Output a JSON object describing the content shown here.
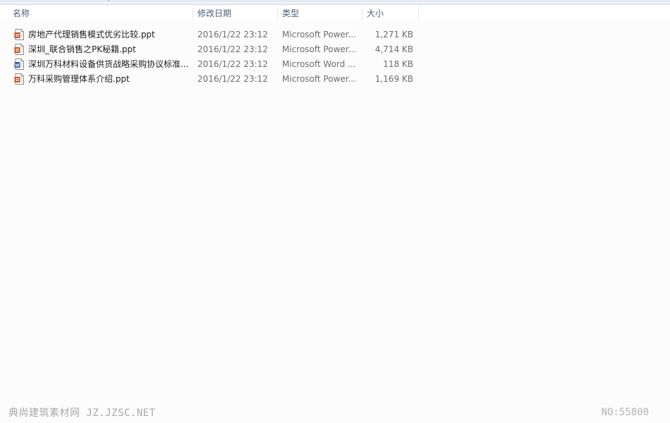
{
  "columns": {
    "name": "名称",
    "date": "修改日期",
    "type": "类型",
    "size": "大小"
  },
  "sort": {
    "column": "name",
    "indicator": "˄"
  },
  "files": [
    {
      "name": "房地产代理销售模式优劣比较.ppt",
      "date": "2016/1/22 23:12",
      "type": "Microsoft Power...",
      "size": "1,271 KB",
      "icon": "powerpoint-file-icon"
    },
    {
      "name": "深圳_联合销售之PK秘籍.ppt",
      "date": "2016/1/22 23:12",
      "type": "Microsoft Power...",
      "size": "4,714 KB",
      "icon": "powerpoint-file-icon"
    },
    {
      "name": "深圳万科材料设备供货战略采购协议标准...",
      "date": "2016/1/22 23:12",
      "type": "Microsoft Word ...",
      "size": "118 KB",
      "icon": "word-file-icon"
    },
    {
      "name": "万科采购管理体系介绍.ppt",
      "date": "2016/1/22 23:12",
      "type": "Microsoft Power...",
      "size": "1,169 KB",
      "icon": "powerpoint-file-icon"
    }
  ],
  "watermark": {
    "left": "典尚建筑素材网 JZ.JZSC.NET",
    "right": "NO:55800"
  },
  "colors": {
    "ppt_icon": "#c4501f",
    "word_icon": "#2b5797",
    "header_text": "#4c607a"
  }
}
